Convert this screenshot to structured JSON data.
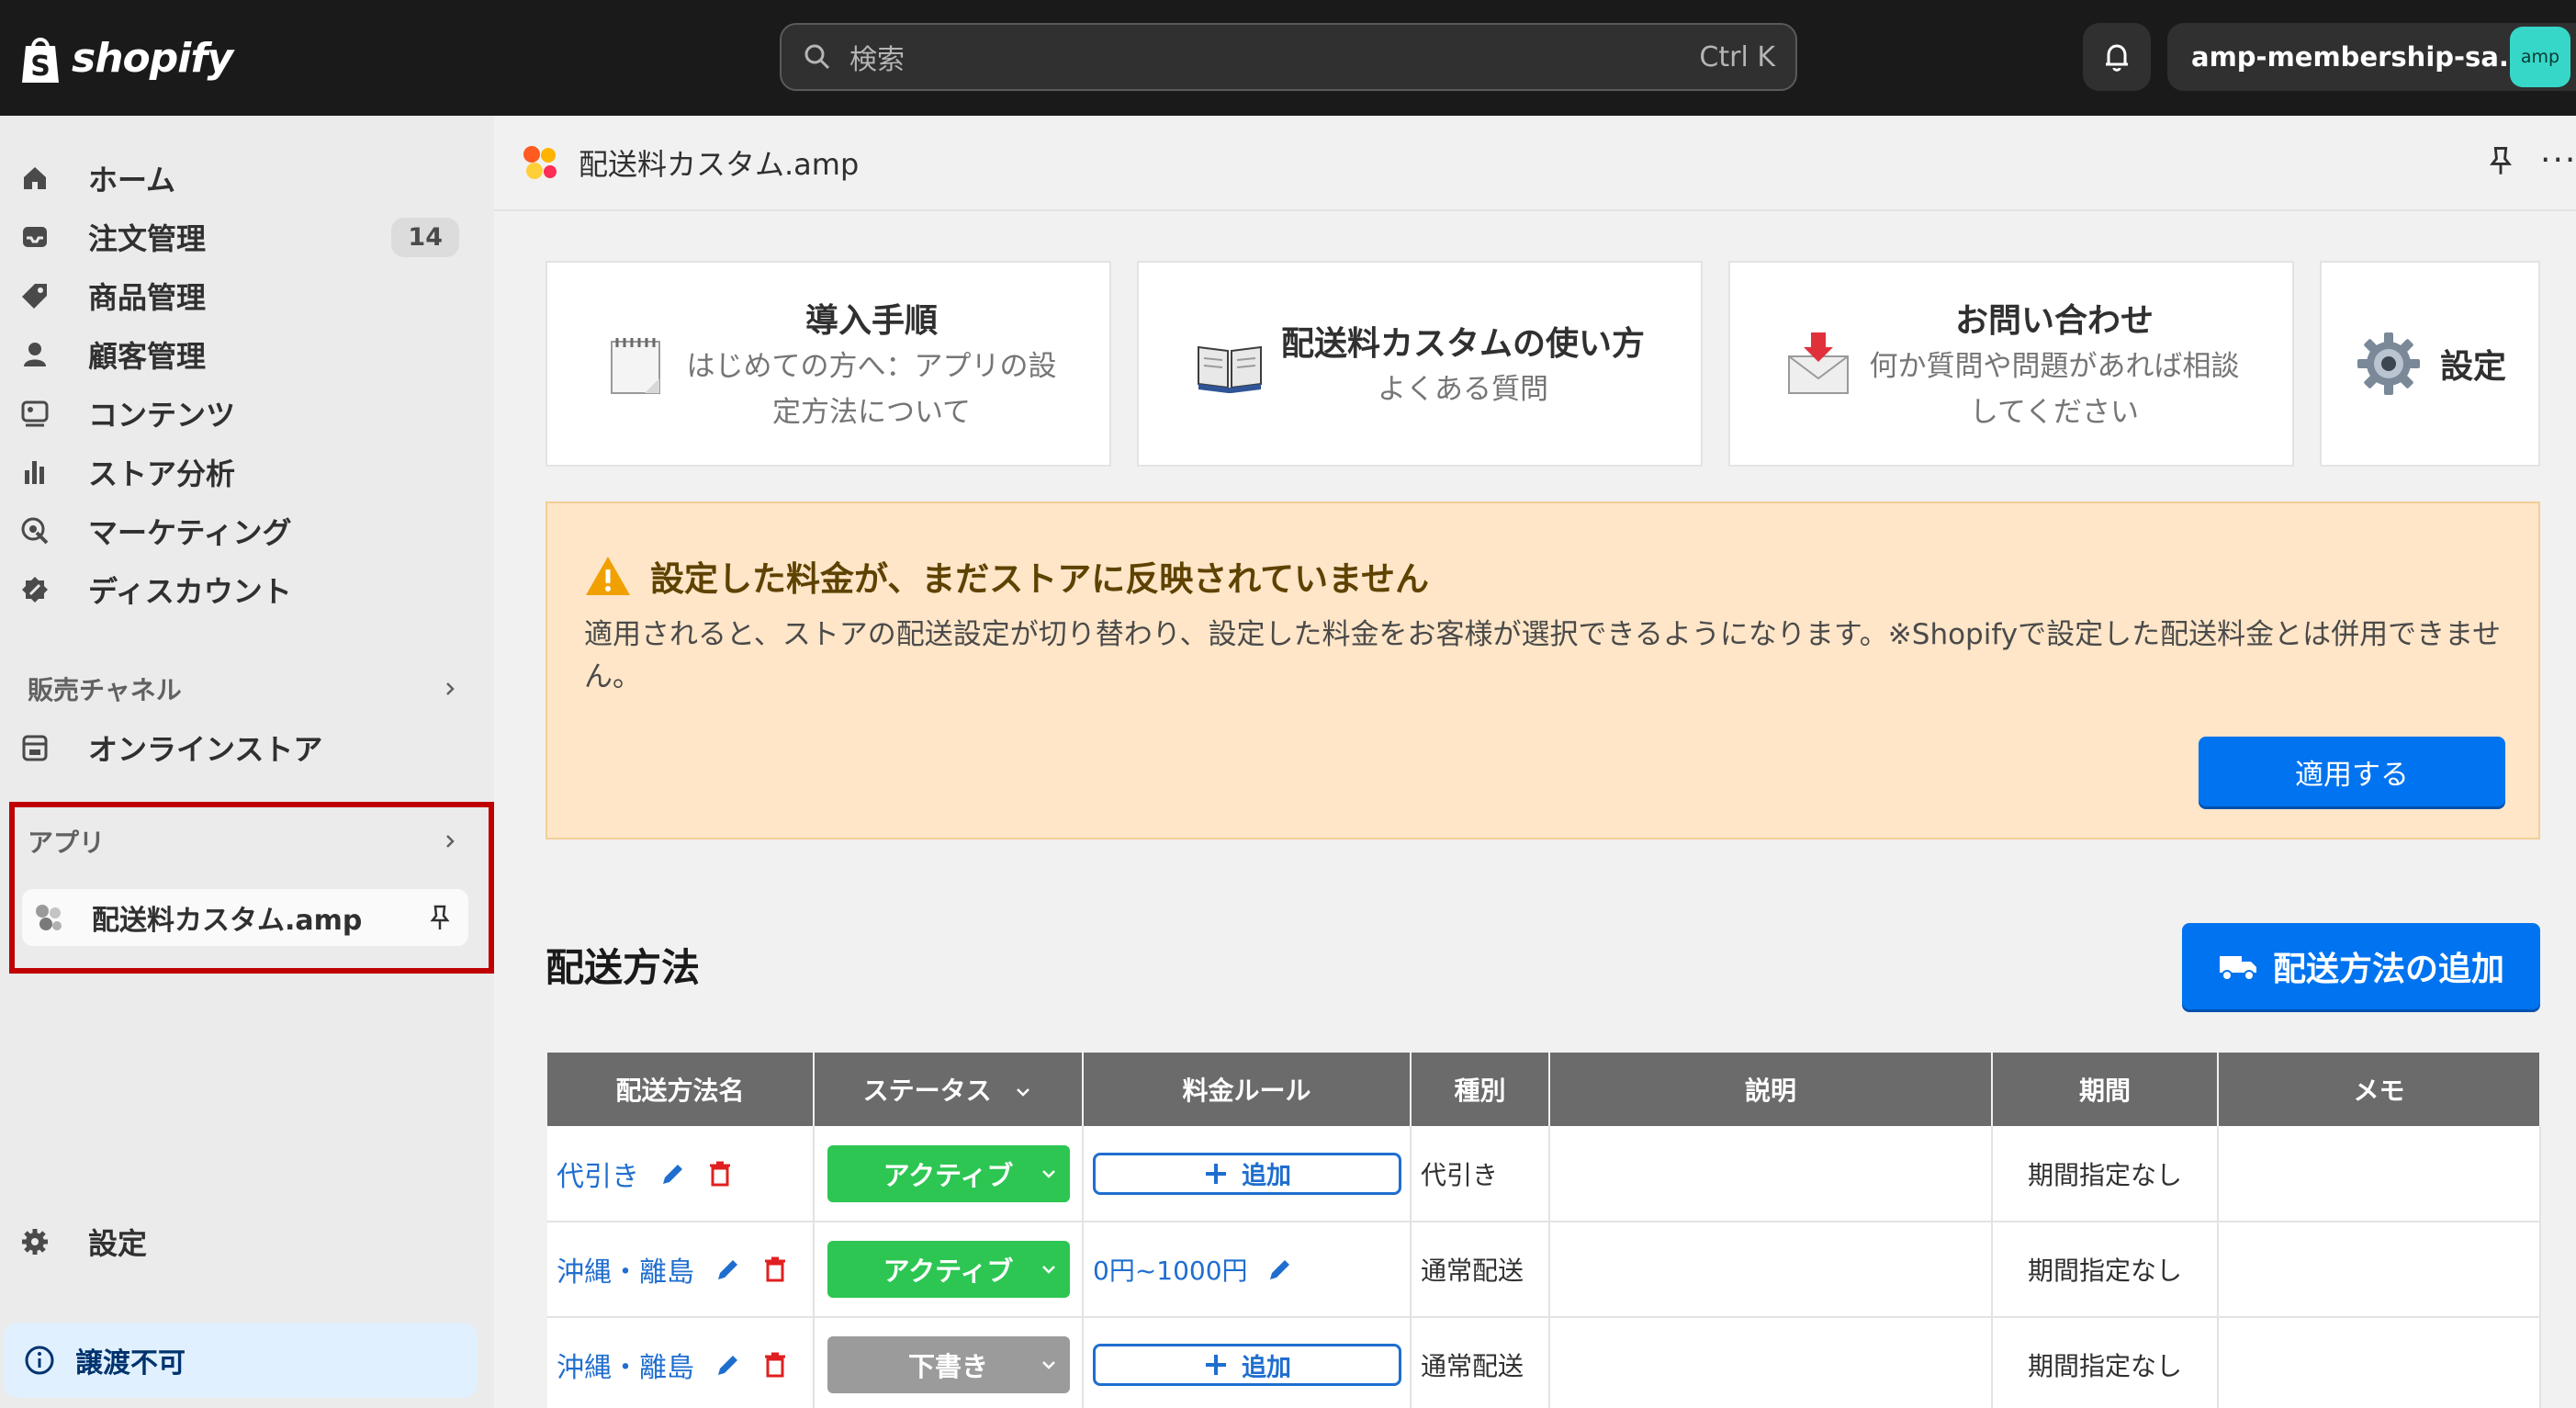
{
  "topbar": {
    "brand": "shopify",
    "search_placeholder": "検索",
    "search_shortcut": "Ctrl K",
    "store_name": "amp-membership-sa...",
    "avatar_text": "amp"
  },
  "sidebar": {
    "items": [
      {
        "label": "ホーム",
        "icon": "home-icon"
      },
      {
        "label": "注文管理",
        "icon": "inbox-icon",
        "badge": "14"
      },
      {
        "label": "商品管理",
        "icon": "tag-icon"
      },
      {
        "label": "顧客管理",
        "icon": "person-icon"
      },
      {
        "label": "コンテンツ",
        "icon": "content-icon"
      },
      {
        "label": "ストア分析",
        "icon": "bar-chart-icon"
      },
      {
        "label": "マーケティング",
        "icon": "target-icon"
      },
      {
        "label": "ディスカウント",
        "icon": "discount-icon"
      }
    ],
    "sales_channel_label": "販売チャネル",
    "online_store_label": "オンラインストア",
    "apps_label": "アプリ",
    "app_name": "配送料カスタム.amp",
    "settings_label": "設定",
    "nontransferable_label": "譲渡不可"
  },
  "app_header": {
    "title": "配送料カスタム.amp"
  },
  "cards": [
    {
      "title": "導入手順",
      "subtitle_line1": "はじめての方へ：アプリの設",
      "subtitle_line2": "定方法について",
      "icon": "notepad-icon"
    },
    {
      "title": "配送料カスタムの使い方",
      "subtitle_line1": "よくある質問",
      "icon": "book-icon"
    },
    {
      "title": "お問い合わせ",
      "subtitle_line1": "何か質問や問題があれば相談",
      "subtitle_line2": "してください",
      "icon": "mail-icon"
    },
    {
      "title": "設定",
      "icon": "gear-icon"
    }
  ],
  "banner": {
    "title": "設定した料金が、まだストアに反映されていません",
    "body": "適用されると、ストアの配送設定が切り替わり、設定した料金をお客様が選択できるようになります。※Shopifyで設定した配送料金とは併用できません。",
    "button": "適用する"
  },
  "methods": {
    "title": "配送方法",
    "add_button": "配送方法の追加",
    "columns": [
      "配送方法名",
      "ステータス",
      "料金ルール",
      "種別",
      "説明",
      "期間",
      "メモ"
    ],
    "rows": [
      {
        "name": "代引き",
        "status": "アクティブ",
        "rule": "追加",
        "type": "代引き",
        "desc": "",
        "period": "期間指定なし",
        "memo": ""
      },
      {
        "name": "沖縄・離島",
        "status": "アクティブ",
        "rule": "0円~1000円",
        "type": "通常配送",
        "desc": "",
        "period": "期間指定なし",
        "memo": ""
      },
      {
        "name": "沖縄・離島",
        "status": "下書き",
        "rule": "追加",
        "type": "通常配送",
        "desc": "",
        "period": "期間指定なし",
        "memo": ""
      }
    ]
  },
  "colors": {
    "primary": "#0073f0",
    "active": "#2dc653",
    "draft": "#9b9b9b",
    "banner_bg": "#ffe6c8",
    "highlight": "#c00000"
  }
}
